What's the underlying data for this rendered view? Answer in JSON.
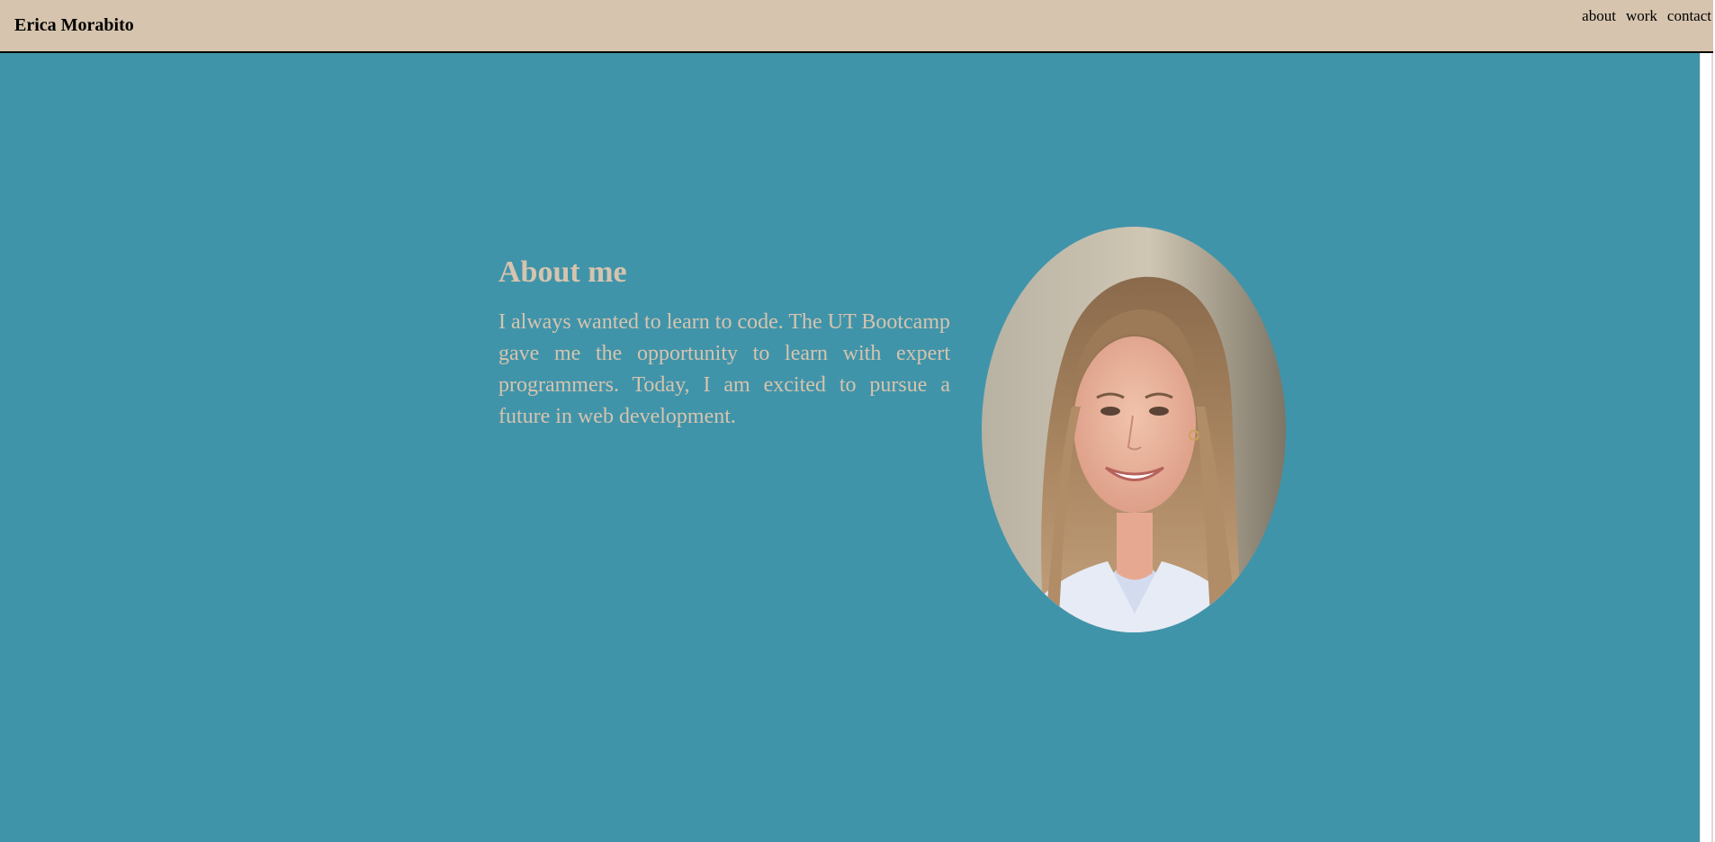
{
  "header": {
    "title": "Erica Morabito",
    "nav": {
      "about": "about",
      "work": "work",
      "contact": "contact"
    }
  },
  "about": {
    "heading": "About me",
    "body": "I always wanted to learn to code. The UT Bootcamp gave me the opportunity to learn with expert programmers. Today, I am excited to pursue a future in web development."
  },
  "portrait": {
    "subject": "headshot photo"
  },
  "colors": {
    "header_bg": "#d6c4ae",
    "hero_bg": "#4094aa",
    "accent_text": "#d6c4ae"
  }
}
